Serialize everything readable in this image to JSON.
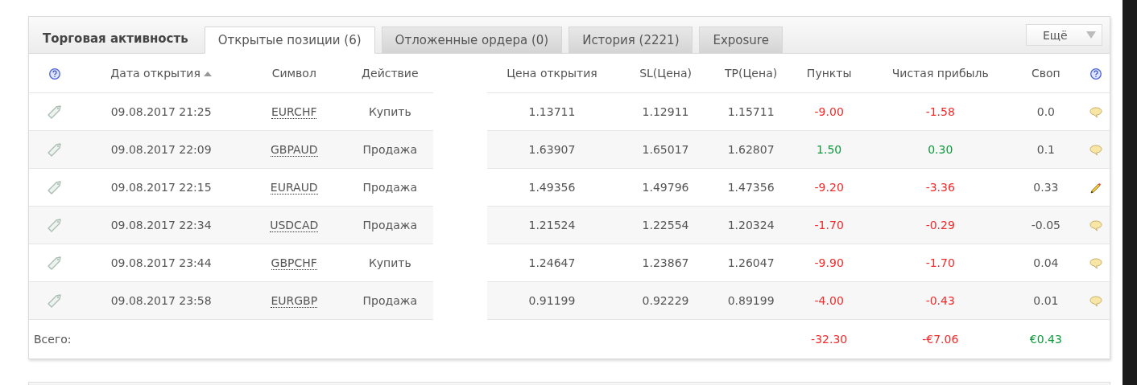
{
  "panel": {
    "title": "Торговая активность",
    "tabs": [
      {
        "label": "Открытые позиции (6)",
        "selected": true
      },
      {
        "label": "Отложенные ордера (0)",
        "selected": false
      },
      {
        "label": "История (2221)",
        "selected": false
      },
      {
        "label": "Exposure",
        "selected": false
      }
    ],
    "more_button": "Ещё"
  },
  "table": {
    "columns": [
      {
        "label": "Дата открытия",
        "sorted": true
      },
      {
        "label": "Символ",
        "sorted": false
      },
      {
        "label": "Действие",
        "sorted": false
      },
      {
        "label": "Цена открытия",
        "sorted": false
      },
      {
        "label": "SL(Цена)",
        "sorted": false
      },
      {
        "label": "TP(Цена)",
        "sorted": false
      },
      {
        "label": "Пункты",
        "sorted": false
      },
      {
        "label": "Чистая прибыль",
        "sorted": false
      },
      {
        "label": "Своп",
        "sorted": false
      }
    ],
    "rows": [
      {
        "kind": "loss",
        "opened": "09.08.2017 21:25",
        "symbol": "EURCHF",
        "action": "Купить",
        "open_price": "1.13711",
        "sl": "1.12911",
        "tp": "1.15711",
        "points": "-9.00",
        "net_profit": "-1.58",
        "swap": "0.0",
        "note": {
          "kind": "comment"
        }
      },
      {
        "kind": "profit",
        "opened": "09.08.2017 22:09",
        "symbol": "GBPAUD",
        "action": "Продажа",
        "open_price": "1.63907",
        "sl": "1.65017",
        "tp": "1.62807",
        "points": "1.50",
        "net_profit": "0.30",
        "swap": "0.1",
        "note": {
          "kind": "comment"
        }
      },
      {
        "kind": "loss",
        "opened": "09.08.2017 22:15",
        "symbol": "EURAUD",
        "action": "Продажа",
        "open_price": "1.49356",
        "sl": "1.49796",
        "tp": "1.47356",
        "points": "-9.20",
        "net_profit": "-3.36",
        "swap": "0.33",
        "note": {
          "kind": "edit"
        }
      },
      {
        "kind": "loss",
        "opened": "09.08.2017 22:34",
        "symbol": "USDCAD",
        "action": "Продажа",
        "open_price": "1.21524",
        "sl": "1.22554",
        "tp": "1.20324",
        "points": "-1.70",
        "net_profit": "-0.29",
        "swap": "-0.05",
        "note": {
          "kind": "comment"
        }
      },
      {
        "kind": "loss",
        "opened": "09.08.2017 23:44",
        "symbol": "GBPCHF",
        "action": "Купить",
        "open_price": "1.24647",
        "sl": "1.23867",
        "tp": "1.26047",
        "points": "-9.90",
        "net_profit": "-1.70",
        "swap": "0.04",
        "note": {
          "kind": "comment"
        }
      },
      {
        "kind": "loss",
        "opened": "09.08.2017 23:58",
        "symbol": "EURGBP",
        "action": "Продажа",
        "open_price": "0.91199",
        "sl": "0.92229",
        "tp": "0.89199",
        "points": "-4.00",
        "net_profit": "-0.43",
        "swap": "0.01",
        "note": {
          "kind": "comment"
        }
      }
    ],
    "totals": {
      "label": "Всего:",
      "points": {
        "value": "-32.30",
        "kind": "loss"
      },
      "net_profit": {
        "value": "-€7.06",
        "kind": "loss"
      },
      "swap": {
        "value": "€0.43",
        "kind": "profit"
      }
    }
  }
}
